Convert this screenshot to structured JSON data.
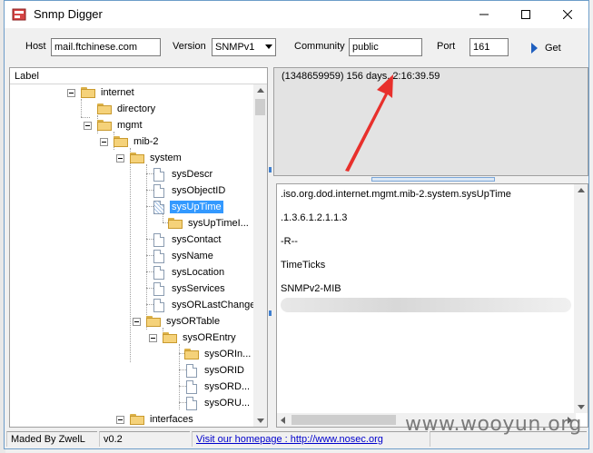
{
  "window": {
    "title": "Snmp Digger"
  },
  "toolbar": {
    "host_label": "Host",
    "host_value": "mail.ftchinese.com",
    "version_label": "Version",
    "version_value": "SNMPv1",
    "community_label": "Community",
    "community_value": "public",
    "port_label": "Port",
    "port_value": "161",
    "get_label": "Get"
  },
  "tree": {
    "header": "Label",
    "nodes": [
      {
        "label": "internet"
      },
      {
        "label": "directory"
      },
      {
        "label": "mgmt"
      },
      {
        "label": "mib-2"
      },
      {
        "label": "system"
      },
      {
        "label": "sysDescr"
      },
      {
        "label": "sysObjectID"
      },
      {
        "label": "sysUpTime"
      },
      {
        "label": "sysUpTimeI..."
      },
      {
        "label": "sysContact"
      },
      {
        "label": "sysName"
      },
      {
        "label": "sysLocation"
      },
      {
        "label": "sysServices"
      },
      {
        "label": "sysORLastChange"
      },
      {
        "label": "sysORTable"
      },
      {
        "label": "sysOREntry"
      },
      {
        "label": "sysORIn..."
      },
      {
        "label": "sysORID"
      },
      {
        "label": "sysORD..."
      },
      {
        "label": "sysORU..."
      },
      {
        "label": "interfaces"
      }
    ],
    "selected": "sysUpTime"
  },
  "result": {
    "value": "(1348659959) 156 days, 2:16:39.59"
  },
  "details": {
    "oid_name": ".iso.org.dod.internet.mgmt.mib-2.system.sysUpTime",
    "oid_numeric": ".1.3.6.1.2.1.1.3",
    "access": "-R--",
    "syntax": "TimeTicks",
    "module": "SNMPv2-MIB"
  },
  "status": {
    "author": "Maded By ZwelL",
    "version": "v0.2",
    "homepage": "Visit our homepage :  http://www.nosec.org"
  },
  "watermark": "www.wooyun.org",
  "colors": {
    "selection": "#3399ff",
    "annotation_arrow": "#e8302c",
    "get_arrow": "#1f5fbf"
  }
}
